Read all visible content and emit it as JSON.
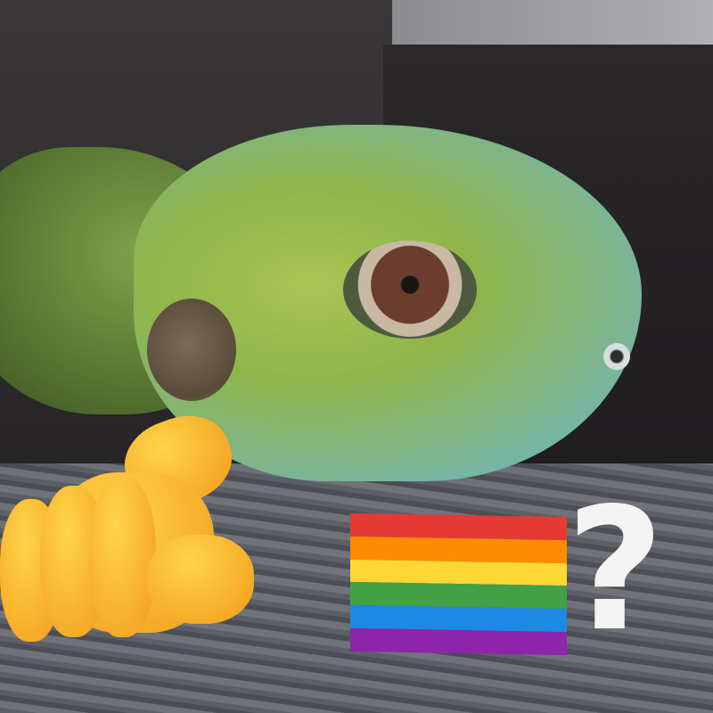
{
  "overlay": {
    "question_mark": "?"
  },
  "emoji": {
    "pointing": "backhand-index-pointing-at-viewer",
    "flag": "rainbow-flag"
  },
  "flag_colors": [
    "#e53935",
    "#fb8c00",
    "#fdd835",
    "#43a047",
    "#1e88e5",
    "#8e24aa"
  ],
  "colors": {
    "lizard_green": "#8fb54a",
    "snout_blue": "#6db6b8",
    "emoji_yellow": "#ffc83d"
  }
}
